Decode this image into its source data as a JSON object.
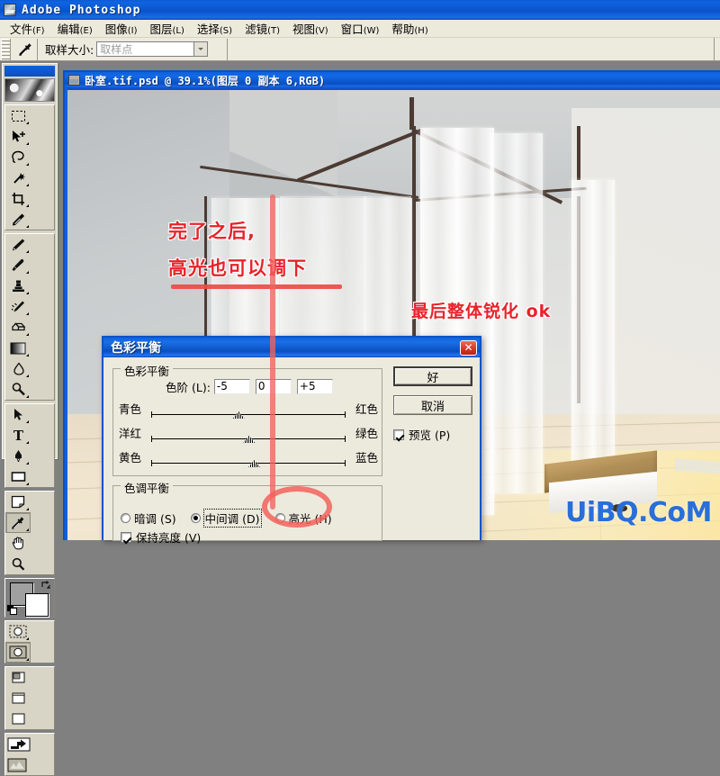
{
  "app": {
    "title": "Adobe Photoshop",
    "icon": "photoshop-app-icon"
  },
  "menubar": {
    "items": [
      {
        "label": "文件",
        "mnemonic": "(F)"
      },
      {
        "label": "编辑",
        "mnemonic": "(E)"
      },
      {
        "label": "图像",
        "mnemonic": "(I)"
      },
      {
        "label": "图层",
        "mnemonic": "(L)"
      },
      {
        "label": "选择",
        "mnemonic": "(S)"
      },
      {
        "label": "滤镜",
        "mnemonic": "(T)"
      },
      {
        "label": "视图",
        "mnemonic": "(V)"
      },
      {
        "label": "窗口",
        "mnemonic": "(W)"
      },
      {
        "label": "帮助",
        "mnemonic": "(H)"
      }
    ]
  },
  "options_bar": {
    "active_tool_icon": "eyedropper-icon",
    "sample_size_label": "取样大小:",
    "sample_size_value": "取样点"
  },
  "toolbox": {
    "groups": [
      {
        "tools": [
          {
            "icon": "marquee-rectangular-icon",
            "selected": false
          },
          {
            "icon": "move-icon",
            "selected": false
          },
          {
            "icon": "lasso-icon",
            "selected": false
          },
          {
            "icon": "magic-wand-icon",
            "selected": false
          },
          {
            "icon": "crop-icon",
            "selected": false
          },
          {
            "icon": "slice-icon",
            "selected": false
          }
        ]
      },
      {
        "tools": [
          {
            "icon": "healing-brush-icon",
            "selected": false
          },
          {
            "icon": "paintbrush-icon",
            "selected": false
          },
          {
            "icon": "clone-stamp-icon",
            "selected": false
          },
          {
            "icon": "history-brush-icon",
            "selected": false
          },
          {
            "icon": "eraser-icon",
            "selected": false
          },
          {
            "icon": "gradient-icon",
            "selected": false
          },
          {
            "icon": "blur-icon",
            "selected": false
          },
          {
            "icon": "dodge-icon",
            "selected": false
          }
        ]
      },
      {
        "tools": [
          {
            "icon": "path-selection-icon",
            "selected": false
          },
          {
            "icon": "type-icon",
            "selected": false
          },
          {
            "icon": "pen-icon",
            "selected": false
          },
          {
            "icon": "rectangle-shape-icon",
            "selected": false
          }
        ]
      },
      {
        "tools": [
          {
            "icon": "notes-icon",
            "selected": false
          },
          {
            "icon": "eyedropper-icon",
            "selected": true
          },
          {
            "icon": "hand-icon",
            "selected": false
          },
          {
            "icon": "zoom-icon",
            "selected": false
          }
        ]
      }
    ],
    "colors": {
      "foreground": "#a0a0a0",
      "background": "#ffffff",
      "swap_icon": "swap-colors-icon",
      "default_icon": "default-colors-icon"
    },
    "mode_buttons": [
      {
        "icon": "standard-mask-mode-icon",
        "selected": false
      },
      {
        "icon": "quick-mask-mode-icon",
        "selected": true
      }
    ],
    "screen_buttons": [
      {
        "icon": "standard-screen-mode-icon",
        "selected": true
      },
      {
        "icon": "full-screen-menubar-mode-icon",
        "selected": false
      },
      {
        "icon": "full-screen-mode-icon",
        "selected": false
      }
    ],
    "jump_buttons": [
      {
        "icon": "jump-to-imageready-icon"
      },
      {
        "icon": "imageready-preview-icon"
      }
    ]
  },
  "document": {
    "title": "卧室.tif.psd @ 39.1%(图层 0 副本 6,RGB)",
    "filename": "卧室.tif.psd",
    "zoom": "39.1%",
    "layer_info": "图层 0 副本 6,RGB",
    "icon": "document-icon"
  },
  "annotations": {
    "line1": "完了之后,",
    "line2": "高光也可以调下",
    "line3": "最后整体锐化   ok",
    "color": "#e8232a",
    "marker_color": "#f2635c",
    "circle_target": "高光 radio button"
  },
  "watermark": {
    "text": "UiBQ.CoM",
    "color": "#2a6fd8"
  },
  "dialog": {
    "title": "色彩平衡",
    "close_icon": "close-icon",
    "balance_group": {
      "legend": "色彩平衡",
      "levels_label": "色阶 (L):",
      "levels": [
        "-5",
        "0",
        "+5"
      ],
      "sliders": [
        {
          "left": "青色",
          "right": "红色",
          "value": -5,
          "thumb_pct": 46
        },
        {
          "left": "洋红",
          "right": "绿色",
          "value": 0,
          "thumb_pct": 50
        },
        {
          "left": "黄色",
          "right": "蓝色",
          "value": 5,
          "thumb_pct": 52
        }
      ]
    },
    "tone_group": {
      "legend": "色调平衡",
      "radios": [
        {
          "label": "暗调 (S)",
          "selected": false,
          "focused": false
        },
        {
          "label": "中间调 (D)",
          "selected": true,
          "focused": true
        },
        {
          "label": "高光 (H)",
          "selected": false,
          "focused": false
        }
      ],
      "preserve_luminosity": {
        "label": "保持亮度 (V)",
        "checked": true
      }
    },
    "buttons": {
      "ok": "好",
      "cancel": "取消"
    },
    "preview": {
      "label": "预览 (P)",
      "checked": true
    }
  }
}
